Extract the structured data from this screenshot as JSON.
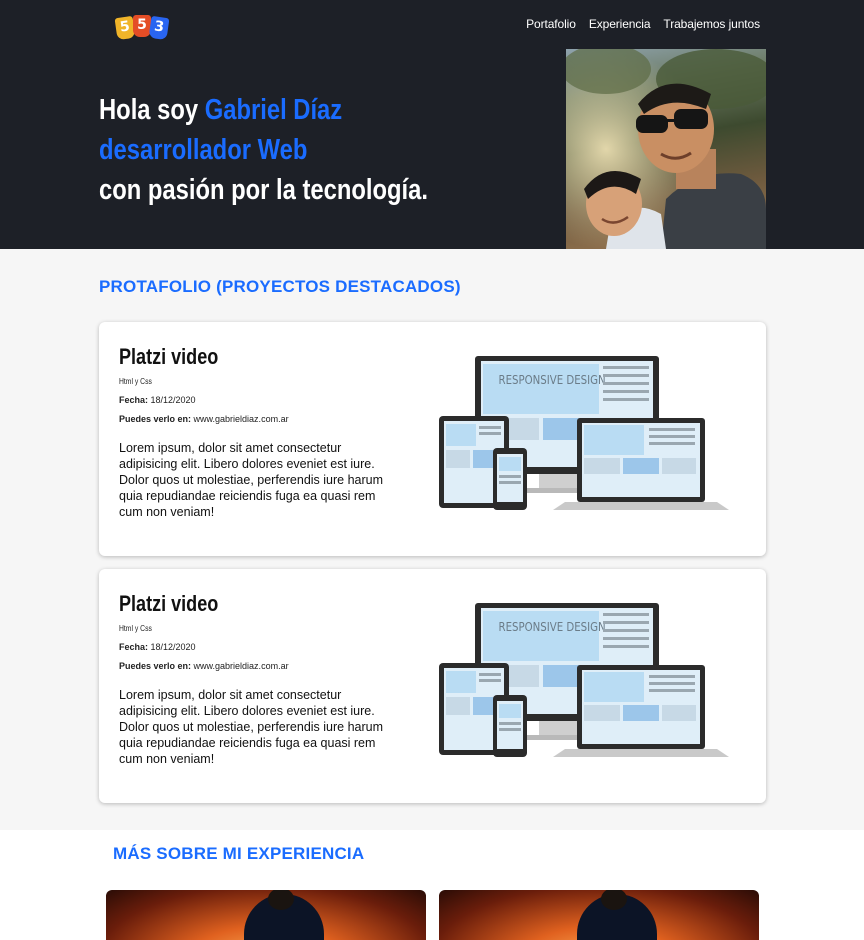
{
  "header": {
    "logo_icon": "html-js-css-badges-icon",
    "nav": [
      "Portafolio",
      "Experiencia",
      "Trabajemos juntos"
    ],
    "hero": {
      "line1_prefix": "Hola soy ",
      "name": "Gabriel Díaz",
      "role": "desarrollador Web",
      "line3": "con pasión por la tecnología."
    }
  },
  "portfolio": {
    "title": "PROTAFOLIO (PROYECTOS DESTACADOS)",
    "cards": [
      {
        "title": "Platzi video",
        "tech": "Html y Css",
        "date_label": "Fecha:",
        "date": " 18/12/2020",
        "link_label": "Puedes verlo en:",
        "link": " www.gabrieldiaz.com.ar",
        "description": "Lorem ipsum, dolor sit amet consectetur adipisicing elit. Libero dolores eveniet est iure. Dolor quos ut molestiae, perferendis iure harum quia repudiandae reiciendis fuga ea quasi rem cum non veniam!",
        "image_text": "RESPONSIVE DESIGN"
      },
      {
        "title": "Platzi video",
        "tech": "Html y Css",
        "date_label": "Fecha:",
        "date": " 18/12/2020",
        "link_label": "Puedes verlo en:",
        "link": " www.gabrieldiaz.com.ar",
        "description": "Lorem ipsum, dolor sit amet consectetur adipisicing elit. Libero dolores eveniet est iure. Dolor quos ut molestiae, perferendis iure harum quia repudiandae reiciendis fuga ea quasi rem cum non veniam!",
        "image_text": "RESPONSIVE DESIGN"
      }
    ]
  },
  "experience": {
    "title": "MÁS SOBRE MI EXPERIENCIA"
  },
  "colors": {
    "header_bg": "#1d2027",
    "accent": "#1a6cff",
    "section_bg": "#f6f6f6"
  }
}
